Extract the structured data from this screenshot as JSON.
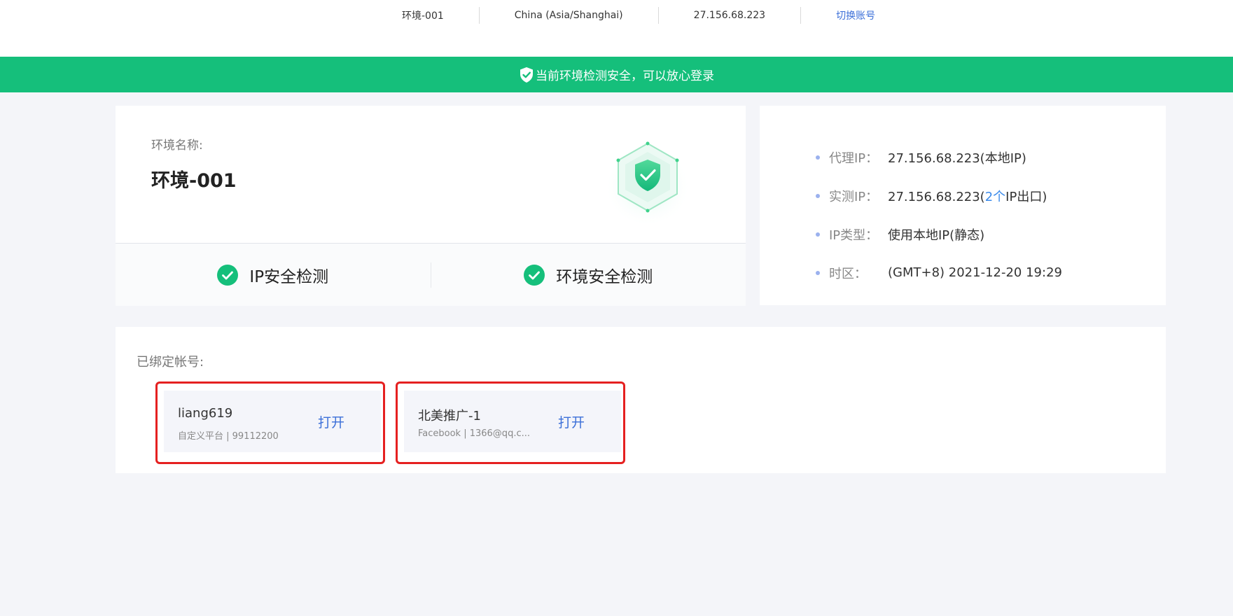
{
  "topbar": {
    "env_name": "环境-001",
    "timezone": "China (Asia/Shanghai)",
    "ip": "27.156.68.223",
    "switch_account": "切换账号"
  },
  "banner": {
    "text": "当前环境检测安全，可以放心登录",
    "color": "#15bf7b"
  },
  "env_card": {
    "label": "环境名称:",
    "name": "环境-001",
    "checks": [
      {
        "label": "IP安全检测",
        "icon": "check-circle-icon"
      },
      {
        "label": "环境安全检测",
        "icon": "check-circle-icon"
      }
    ]
  },
  "ip_info": {
    "proxy": {
      "key": "代理IP：",
      "value": "27.156.68.223(本地IP)"
    },
    "measured": {
      "key": "实测IP：",
      "value_pre": "27.156.68.223(",
      "value_count": "2个",
      "value_post": "IP出口)"
    },
    "type": {
      "key": "IP类型：",
      "value": "使用本地IP(静态)"
    },
    "timezone": {
      "key": "时区：",
      "value": "(GMT+8) 2021-12-20 19:29"
    }
  },
  "bound_accounts": {
    "title": "已绑定帐号:",
    "items": [
      {
        "name": "liang619",
        "sub": "自定义平台 | 99112200",
        "open": "打开"
      },
      {
        "name": "北美推广-1",
        "sub": "Facebook | 1366@qq.c...",
        "open": "打开"
      }
    ]
  },
  "colors": {
    "accent": "#15bf7b",
    "link": "#3b6fd8",
    "highlight_box": "#e52020"
  }
}
